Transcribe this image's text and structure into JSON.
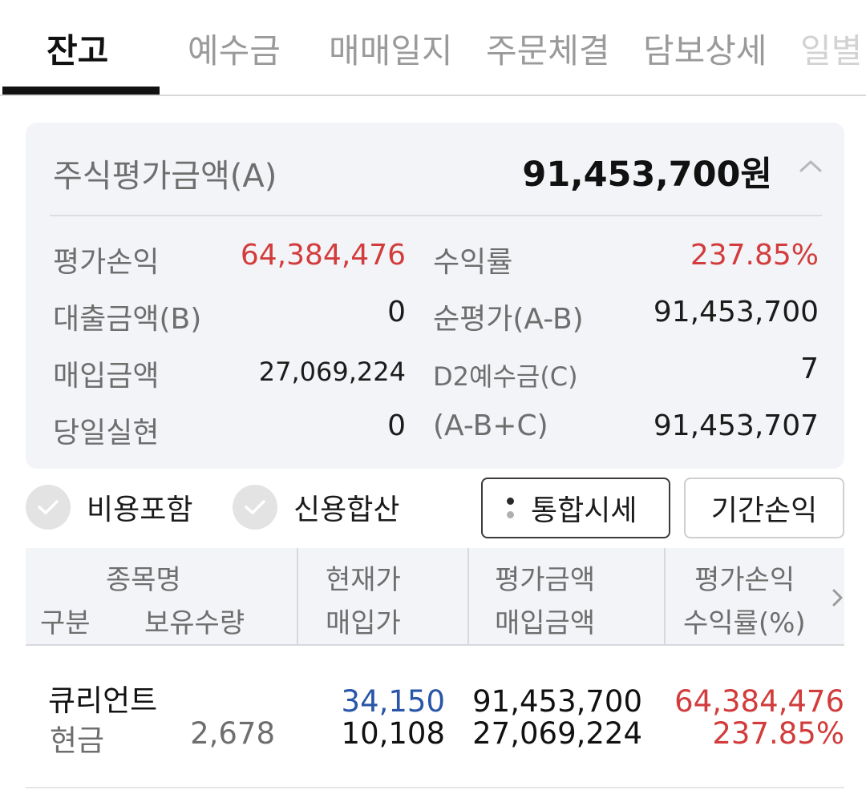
{
  "tabs": [
    {
      "label": "잔고"
    },
    {
      "label": "예수금"
    },
    {
      "label": "매매일지"
    },
    {
      "label": "주문체결"
    },
    {
      "label": "담보상세"
    },
    {
      "label": "일별"
    }
  ],
  "summary": {
    "header_label": "주식평가금액(A)",
    "header_value": "91,453,700원",
    "rows": [
      {
        "left_label": "평가손익",
        "left_value": "64,384,476",
        "right_label": "수익률",
        "right_value": "237.85%"
      },
      {
        "left_label": "대출금액(B)",
        "left_value": "0",
        "right_label": "순평가(A-B)",
        "right_value": "91,453,700"
      },
      {
        "left_label": "매입금액",
        "left_value": "27,069,224",
        "right_label": "D2예수금(C)",
        "right_value": "7"
      },
      {
        "left_label": "당일실현",
        "left_value": "0",
        "right_label": "(A-B+C)",
        "right_value": "91,453,707"
      }
    ]
  },
  "options": {
    "include_fees": "비용포함",
    "credit_combined": "신용합산"
  },
  "buttons": {
    "unified_quote": "통합시세",
    "period_pnl": "기간손익"
  },
  "table": {
    "headers": {
      "col1_top": "종목명",
      "col1_bottom_left": "구분",
      "col1_bottom_right": "보유수량",
      "col2_top": "현재가",
      "col2_bottom": "매입가",
      "col3_top": "평가금액",
      "col3_bottom": "매입금액",
      "col4_top": "평가손익",
      "col4_bottom": "수익률(%)"
    },
    "rows": [
      {
        "name": "큐리언트",
        "type": "현금",
        "quantity": "2,678",
        "current_price": "34,150",
        "buy_price": "10,108",
        "eval_amount": "91,453,700",
        "buy_amount": "27,069,224",
        "eval_pnl": "64,384,476",
        "return_rate": "237.85%"
      }
    ]
  },
  "colors": {
    "profit_red": "#d23c3c",
    "price_blue": "#2956a8",
    "card_bg": "#f3f4f7"
  },
  "icons": {
    "collapse": "chevron-up-icon",
    "scroll_right": "chevron-right-icon",
    "check": "check-icon"
  }
}
